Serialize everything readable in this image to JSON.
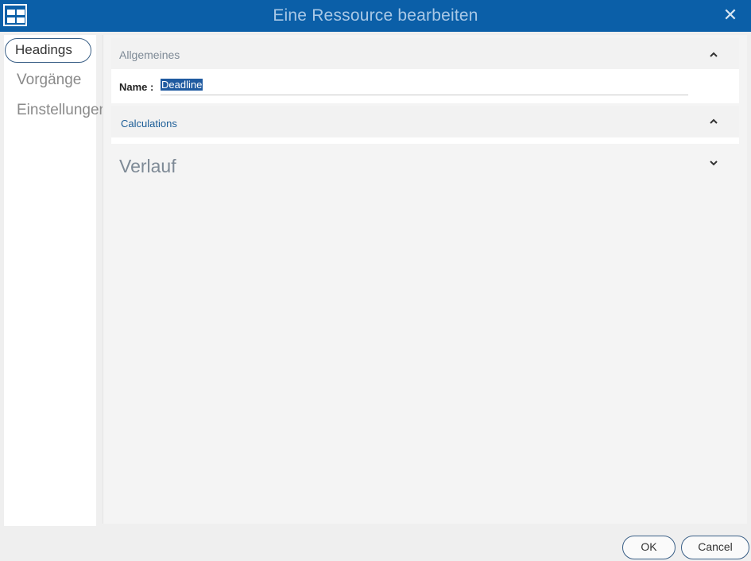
{
  "window": {
    "title": "Eine Ressource bearbeiten"
  },
  "sidebar": {
    "items": [
      {
        "label": "Headings",
        "active": true
      },
      {
        "label": "Vorgänge",
        "active": false
      },
      {
        "label": "Einstellungen",
        "active": false
      }
    ]
  },
  "sections": {
    "general": {
      "title": "Allgemeines",
      "expanded": true
    },
    "name_field": {
      "label": "Name :",
      "value": "Deadline"
    },
    "calculations": {
      "title": "Calculations",
      "expanded": true
    },
    "history": {
      "title": "Verlauf",
      "expanded": false
    }
  },
  "footer": {
    "ok_label": "OK",
    "cancel_label": "Cancel"
  },
  "colors": {
    "titlebar": "#0b5fa8",
    "accent": "#3a5f86",
    "selection": "#1f5aa0",
    "link": "#1a5c96"
  }
}
